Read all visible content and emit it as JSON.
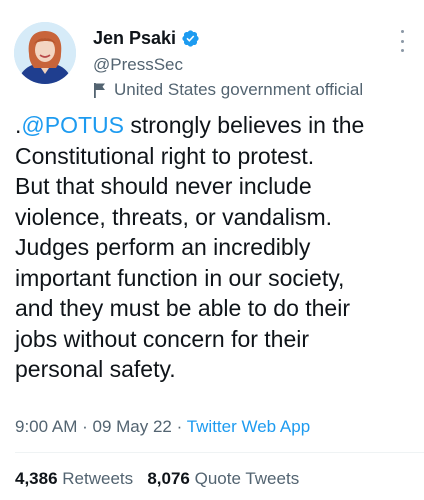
{
  "author": {
    "display_name": "Jen Psaki",
    "handle": "@PressSec",
    "label": "United States government official",
    "verified": true
  },
  "tweet": {
    "prefix": ".",
    "mention": "@POTUS",
    "body": " strongly believes in the\nConstitutional right to protest.\nBut that should never include\nviolence, threats, or vandalism.\nJudges perform an incredibly\nimportant function in our society,\nand they must be able to do their\njobs without concern for their\npersonal safety."
  },
  "meta": {
    "time": "9:00 AM",
    "date": "09 May 22",
    "separator": " · ",
    "source": "Twitter Web App"
  },
  "stats": {
    "retweets_count": "4,386",
    "retweets_label": "Retweets",
    "quotes_count": "8,076",
    "quotes_label": "Quote Tweets"
  },
  "colors": {
    "accent": "#1d9bf0",
    "secondary_text": "#536471",
    "primary_text": "#0f1419"
  },
  "icons": {
    "verified": "verified-badge-icon",
    "label": "government-flag-icon",
    "more": "more-options-icon"
  }
}
